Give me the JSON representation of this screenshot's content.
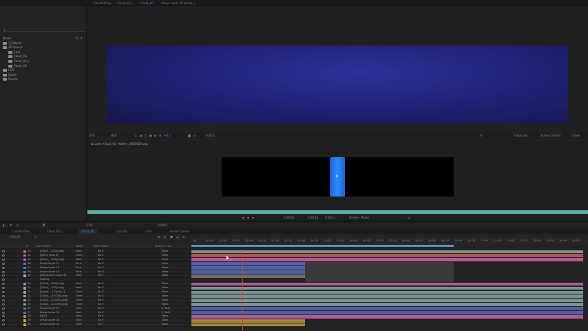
{
  "top_tabs": [
    {
      "label": "Cloud01Only",
      "active": false
    },
    {
      "label": "Cloud_4G_L",
      "active": false
    },
    {
      "label": "Cloud_4G",
      "active": true
    },
    {
      "label": "Shape Layer 19 (comp_)",
      "active": false
    }
  ],
  "project": {
    "search_icon": "search-icon",
    "items": [
      {
        "label": "Name",
        "indent": 0
      },
      {
        "label": "1_Output",
        "indent": 0
      },
      {
        "label": "2D Source",
        "indent": 0
      },
      {
        "label": "Clud",
        "indent": 1
      },
      {
        "label": "Cloud_4G",
        "indent": 1
      },
      {
        "label": "Cloud_4G_L",
        "indent": 1
      },
      {
        "label": "Cloud_4G",
        "indent": 1
      },
      {
        "label": "HUD",
        "indent": 0
      },
      {
        "label": "Solids",
        "indent": 0
      },
      {
        "label": "Source",
        "indent": 0
      }
    ]
  },
  "comp_toolbar": {
    "zoom": "50%",
    "resolution": "Half",
    "timecode": "0;00;0",
    "exposure": "+0.0",
    "active_camera": "Active Camera",
    "views": "1 View",
    "comp_name": "Cloud_4G"
  },
  "layer_viewer": {
    "title": "Layer: Cloud_4G_Hidden_1BDE4Z0.png"
  },
  "layer_controls": {
    "in_point": "0;00;00",
    "duration": "0;00;16",
    "out_point": "0;00;11",
    "view_label": "Render",
    "view_value": "Masks"
  },
  "timeline_tabs": [
    {
      "label": "Cloud01Only",
      "active": false
    },
    {
      "label": "Cloud_4G_L",
      "active": false
    },
    {
      "label": "Cloud_4G",
      "active": true
    },
    {
      "label": "Clud_4G",
      "active": false
    },
    {
      "label": "Clud",
      "active": false
    },
    {
      "label": "Render Queue",
      "active": false
    }
  ],
  "timeline_tools": {
    "zoom": "25%",
    "current_time": "0;00;03",
    "timecode_small": "0;00;0"
  },
  "columns": {
    "num": "#",
    "layer_name": "Layer Name",
    "mode": "Mode",
    "trkmat": "Track Matte",
    "parent": "Parent & Link"
  },
  "layers": [
    {
      "num": "13",
      "name": "[Cloud_...150].png]",
      "mode": "Norn",
      "trk": "No V",
      "parent": "None",
      "label": "#a16a6a"
    },
    {
      "num": "14",
      "name": "[White Solid 6]",
      "mode": "Overl",
      "trk": "No V",
      "parent": "None",
      "label": "#c46c6c"
    },
    {
      "num": "15",
      "name": "[Cloud_...150].png]",
      "mode": "Norn",
      "trk": "No V",
      "parent": "None",
      "label": "#b46ab4"
    },
    {
      "num": "16",
      "name": "Shape Layer 17",
      "mode": "Scre",
      "trk": "No V",
      "parent": "None",
      "label": "#5b6ac8"
    },
    {
      "num": "17",
      "name": "Shape Layer 15",
      "mode": "Scre",
      "trk": "No V",
      "parent": "None",
      "label": "#5b6ac8"
    },
    {
      "num": "18",
      "name": "Shape Layer 14",
      "mode": "Scre",
      "trk": "No V",
      "parent": "None",
      "label": "#5b6ac8"
    },
    {
      "num": "19",
      "name": "[Adjustment Layer 6]",
      "mode": "Norn",
      "trk": "No V",
      "parent": "None",
      "label": "#a1a1a1"
    },
    {
      "num": "",
      "name": "Opacity",
      "mode": "",
      "trk": "",
      "parent": "",
      "label": "#232323"
    },
    {
      "num": "20",
      "name": "[Cloud_...150].png]",
      "mode": "Norn",
      "trk": "No V",
      "parent": "None",
      "label": "#c46cc4"
    },
    {
      "num": "21",
      "name": "[Cloud_...150].png]",
      "mode": "Norn",
      "trk": "No V",
      "parent": "None",
      "label": "#8aa3a3"
    },
    {
      "num": "22",
      "name": "[Shape ...1 Comp 1]",
      "mode": "Overl",
      "trk": "No V",
      "parent": "None",
      "label": "#8aa3a3"
    },
    {
      "num": "23",
      "name": "[Cloud_...0-0136].png]",
      "mode": "Overl",
      "trk": "No V",
      "parent": "None",
      "label": "#8aa3a3"
    },
    {
      "num": "24",
      "name": "[Cloud_...0-0150].png]",
      "mode": "Overl",
      "trk": "No V",
      "parent": "None",
      "label": "#8aa3a3"
    },
    {
      "num": "25",
      "name": "[Cloud_...0-0156].png]",
      "mode": "Overl",
      "trk": "No V",
      "parent": "None",
      "label": "#8aa3a3"
    },
    {
      "num": "26",
      "name": "Shape Layer 37",
      "mode": "Norn",
      "trk": "No V",
      "parent": "2. Null",
      "label": "#5b6ac8"
    },
    {
      "num": "27",
      "name": "Shape Layer 32",
      "mode": "Norn",
      "trk": "No V",
      "parent": "2. Null",
      "label": "#5b6ac8"
    },
    {
      "num": "28",
      "name": "[Null]",
      "mode": "Norn",
      "trk": "No V",
      "parent": "None",
      "label": "#c46c6c"
    },
    {
      "num": "29",
      "name": "Shape Layer 33",
      "mode": "Norn",
      "trk": "No V",
      "parent": "None",
      "label": "#c4a53c"
    },
    {
      "num": "30",
      "name": "Shape Layer 32",
      "mode": "Norn",
      "trk": "No V",
      "parent": "None",
      "label": "#c4a53c"
    }
  ],
  "ruler_ticks": [
    "00f",
    "00:15f",
    "01:00f",
    "01:15f",
    "02:00f",
    "02:15f",
    "03:00f",
    "03:15f",
    "04:00f",
    "04:15f",
    "05:00f",
    "05:15f",
    "06:00f",
    "06:15f",
    "07:00f",
    "07:15f",
    "08:00f",
    "08:15f",
    "09:00f",
    "09:15f",
    "10:00f",
    "10:15f",
    "11:00f",
    "11:15f",
    "12:00f",
    "12:15f",
    "13:00f",
    "13:15f",
    "14:00f",
    "14:15f"
  ],
  "bar_colors": {
    "red": "#b45252",
    "pink": "#b45a96",
    "blue": "#5460a6",
    "grey": "#6f7070",
    "teal": "#7a9392",
    "sage": "#7d9382",
    "gold": "#a3893a",
    "dark": "#3a3a3a"
  },
  "accent": "#2d8ceb"
}
